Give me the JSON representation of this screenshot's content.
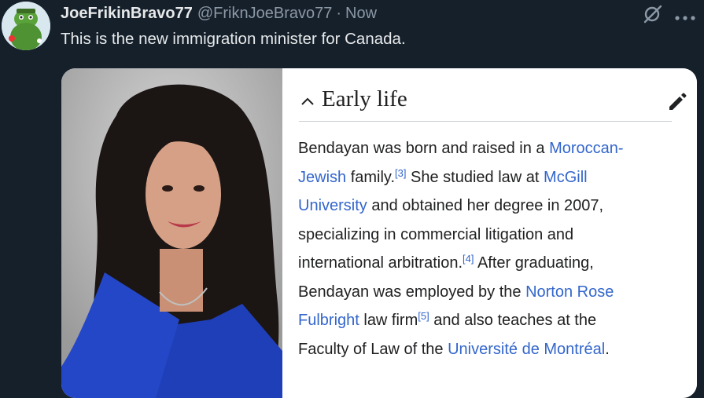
{
  "tweet": {
    "display_name": "JoeFrikinBravo77",
    "handle": "@FriknJoeBravo77",
    "separator": "·",
    "time": "Now",
    "text": "This is the new immigration minister for Canada.",
    "icons": [
      "avatar",
      "grok-icon",
      "more-icon"
    ]
  },
  "wiki": {
    "heading": "Early life",
    "icons": [
      "chevron-up-icon",
      "pencil-icon"
    ],
    "lines": [
      [
        {
          "t": "Bendayan was born and raised in a "
        },
        {
          "t": "Moroccan-",
          "link": true
        }
      ],
      [
        {
          "t": "Jewish",
          "link": true
        },
        {
          "t": " family."
        },
        {
          "t": "[3]",
          "sup": true
        },
        {
          "t": " She studied law at "
        },
        {
          "t": "McGill",
          "link": true
        }
      ],
      [
        {
          "t": "University",
          "link": true
        },
        {
          "t": " and obtained her degree in 2007,"
        }
      ],
      [
        {
          "t": "specializing in commercial litigation and"
        }
      ],
      [
        {
          "t": "international arbitration."
        },
        {
          "t": "[4]",
          "sup": true
        },
        {
          "t": " After graduating,"
        }
      ],
      [
        {
          "t": "Bendayan was employed by the "
        },
        {
          "t": "Norton Rose",
          "link": true
        }
      ],
      [
        {
          "t": "Fulbright",
          "link": true
        },
        {
          "t": " law firm"
        },
        {
          "t": "[5]",
          "sup": true
        },
        {
          "t": " and also teaches at the"
        }
      ],
      [
        {
          "t": "Faculty of Law of the "
        },
        {
          "t": "Université de Montréal",
          "link": true
        },
        {
          "t": "."
        }
      ]
    ]
  }
}
